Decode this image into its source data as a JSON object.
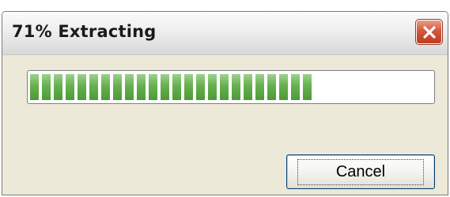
{
  "window": {
    "title": "71% Extracting",
    "close_icon": "close-icon"
  },
  "progress": {
    "percent": 71
  },
  "buttons": {
    "cancel_label": "Cancel"
  },
  "colors": {
    "progress_green": "#66b04e",
    "close_red": "#c23c20",
    "dialog_bg": "#ece9d8"
  }
}
